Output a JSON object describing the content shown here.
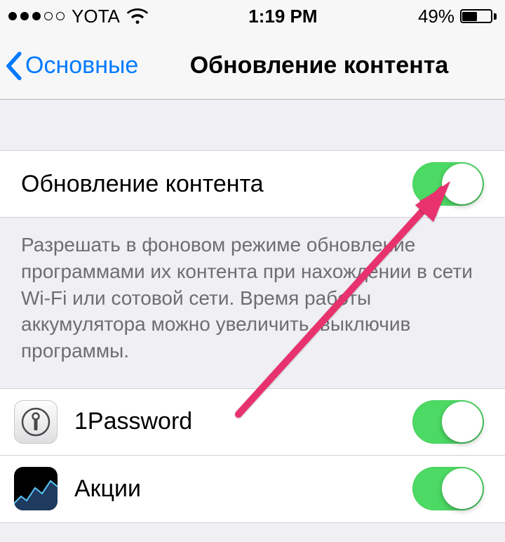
{
  "status": {
    "carrier": "YOTA",
    "time": "1:19 PM",
    "battery_pct": "49%"
  },
  "nav": {
    "back": "Основные",
    "title": "Обновление контента"
  },
  "master": {
    "label": "Обновление контента",
    "on": true
  },
  "footer_text": "Разрешать в фоновом режиме обновление программами их контента при нахождении в сети Wi-Fi или сотовой сети. Время работы аккумулятора можно увеличить, выключив программы.",
  "apps": [
    {
      "name": "1Password",
      "on": true,
      "icon": "onepassword"
    },
    {
      "name": "Акции",
      "on": true,
      "icon": "stocks"
    }
  ],
  "colors": {
    "accent": "#007aff",
    "switch_on": "#4cd964",
    "bg": "#efeff4"
  }
}
